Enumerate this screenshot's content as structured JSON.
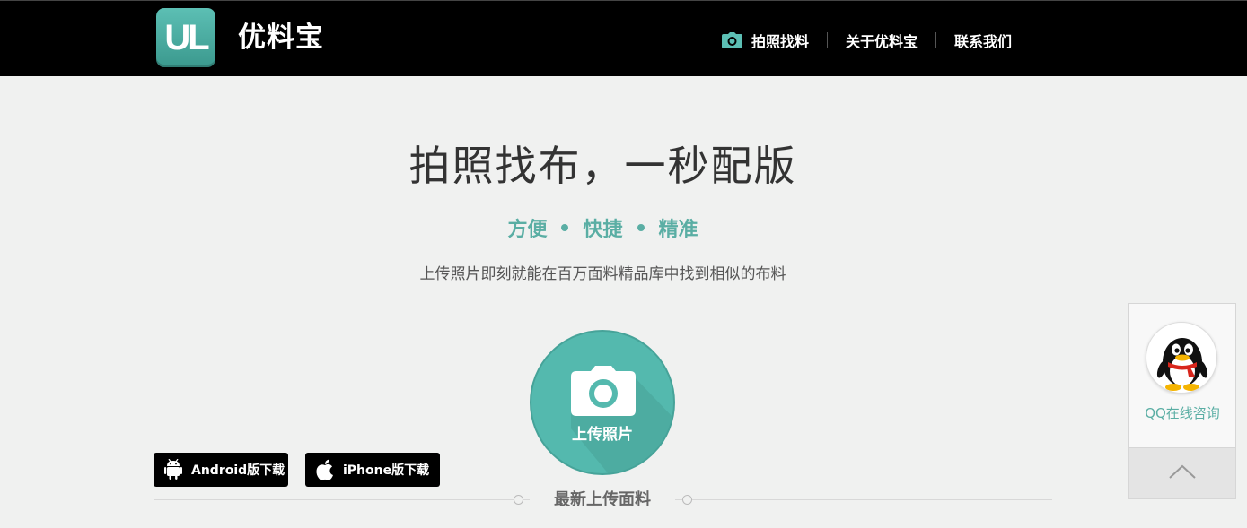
{
  "header": {
    "logo_text": "UL",
    "brand_name": "优料宝",
    "nav": [
      {
        "label": "拍照找料",
        "icon": "camera-icon"
      },
      {
        "label": "关于优料宝"
      },
      {
        "label": "联系我们"
      }
    ]
  },
  "hero": {
    "title": "拍照找布，一秒配版",
    "tags": [
      "方便",
      "快捷",
      "精准"
    ],
    "subtitle": "上传照片即刻就能在百万面料精品库中找到相似的布料"
  },
  "upload": {
    "label": "上传照片",
    "icon": "camera-icon"
  },
  "downloads": {
    "android": {
      "label": "Android版下载",
      "icon": "android-icon"
    },
    "iphone": {
      "label": "iPhone版下载",
      "icon": "apple-icon"
    }
  },
  "section": {
    "title": "最新上传面料"
  },
  "float_panel": {
    "qq_label": "QQ在线咨询",
    "qq_icon": "qq-penguin-icon",
    "back_to_top_icon": "chevron-up-icon"
  },
  "colors": {
    "accent": "#54b9ae",
    "header_bg": "#000000",
    "page_bg": "#f0f1f0"
  }
}
